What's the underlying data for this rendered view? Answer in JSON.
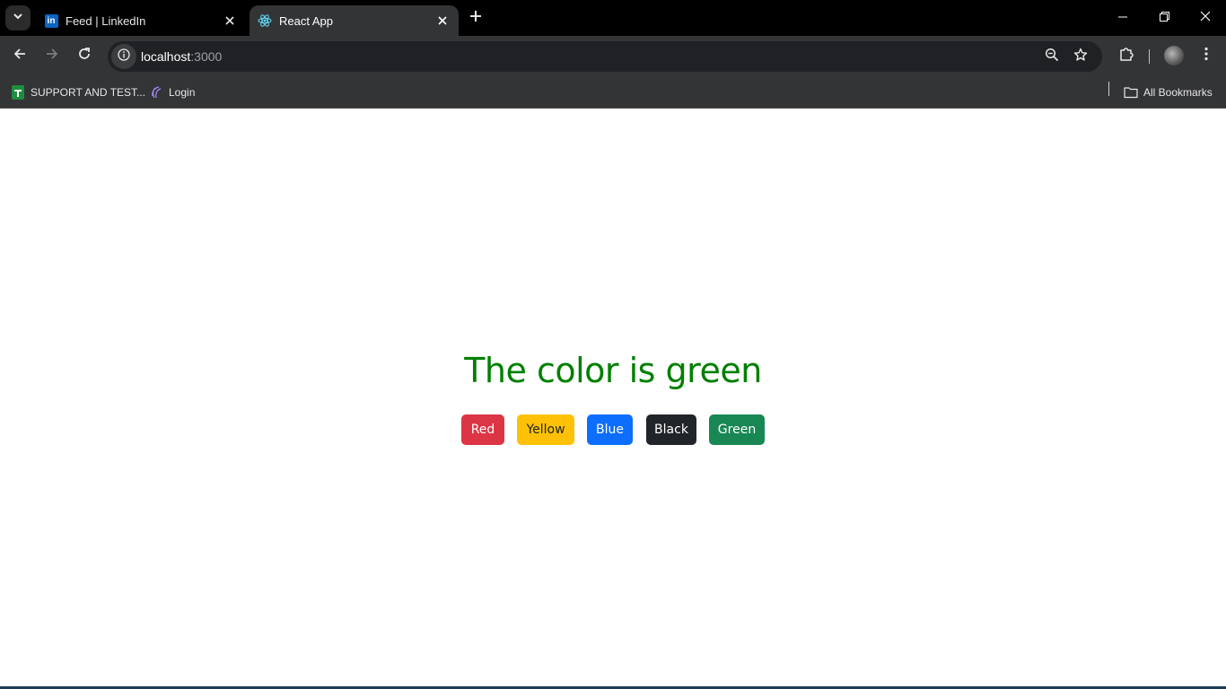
{
  "tabs": [
    {
      "title": "Feed | LinkedIn",
      "favicon": "linkedin-icon",
      "active": false
    },
    {
      "title": "React App",
      "favicon": "react-icon",
      "active": true
    }
  ],
  "omnibox": {
    "host": "localhost",
    "port": ":3000"
  },
  "bookmarks": [
    {
      "label": "SUPPORT AND TEST...",
      "icon": "sheets-icon"
    },
    {
      "label": "Login",
      "icon": "login-site-icon"
    }
  ],
  "all_bookmarks_label": "All Bookmarks",
  "page": {
    "heading": "The color is green",
    "buttons": [
      {
        "label": "Red",
        "color": "#dc3545",
        "text_color": "#ffffff"
      },
      {
        "label": "Yellow",
        "color": "#ffc107",
        "text_color": "#212529"
      },
      {
        "label": "Blue",
        "color": "#0d6efd",
        "text_color": "#ffffff"
      },
      {
        "label": "Black",
        "color": "#212529",
        "text_color": "#ffffff"
      },
      {
        "label": "Green",
        "color": "#198754",
        "text_color": "#ffffff"
      }
    ]
  }
}
